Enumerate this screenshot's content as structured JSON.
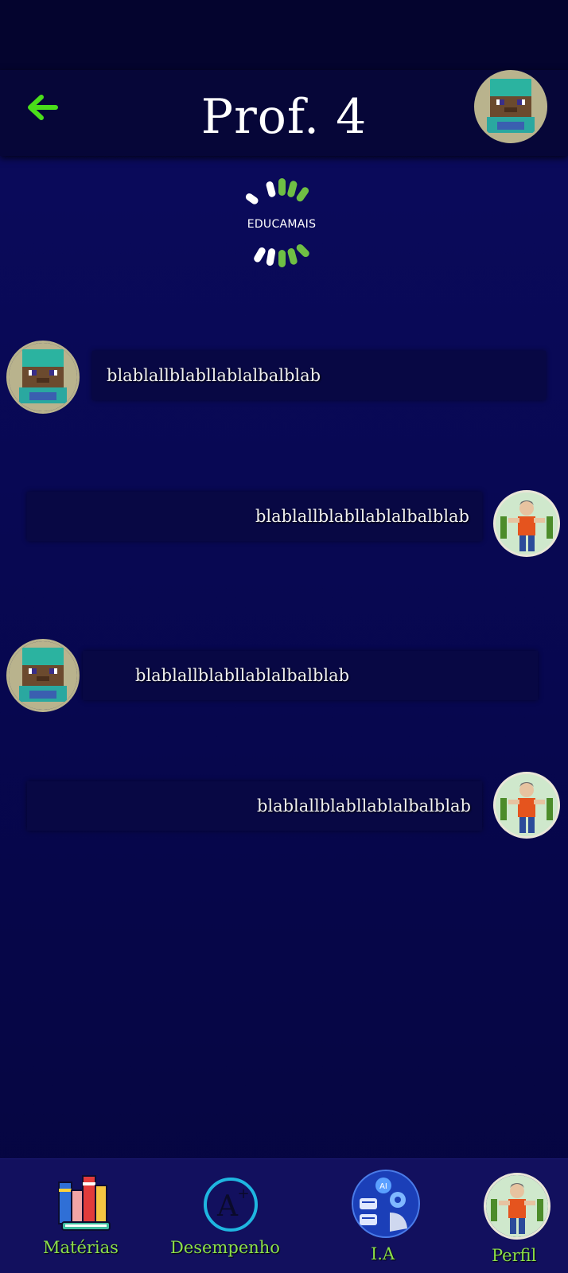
{
  "header": {
    "title": "Prof. 4",
    "back_icon": "arrow-left-icon",
    "back_color": "#4ade1a"
  },
  "logo": {
    "text": "EDUCAMAIS",
    "colors": [
      "#ffffff",
      "#6fbf44"
    ]
  },
  "messages": [
    {
      "side": "left",
      "text": "blablallblabllablalbalblab",
      "avatar": "minecraft-steve-avatar"
    },
    {
      "side": "right",
      "text": "blablallblabllablalbalblab",
      "avatar": "student-avatar"
    },
    {
      "side": "left",
      "text": "blablallblabllablalbalblab",
      "avatar": "minecraft-steve-avatar"
    },
    {
      "side": "right",
      "text": "blablallblabllablalbalblab",
      "avatar": "student-avatar"
    }
  ],
  "bottom_nav": {
    "items": [
      {
        "label": "Matérias",
        "icon": "books-icon"
      },
      {
        "label": "Desempenho",
        "icon": "grade-a-plus-icon"
      },
      {
        "label": "I.A",
        "icon": "ai-robot-icon"
      },
      {
        "label": "Perfil",
        "icon": "profile-avatar-icon"
      }
    ],
    "label_color": "#8ce04a"
  }
}
